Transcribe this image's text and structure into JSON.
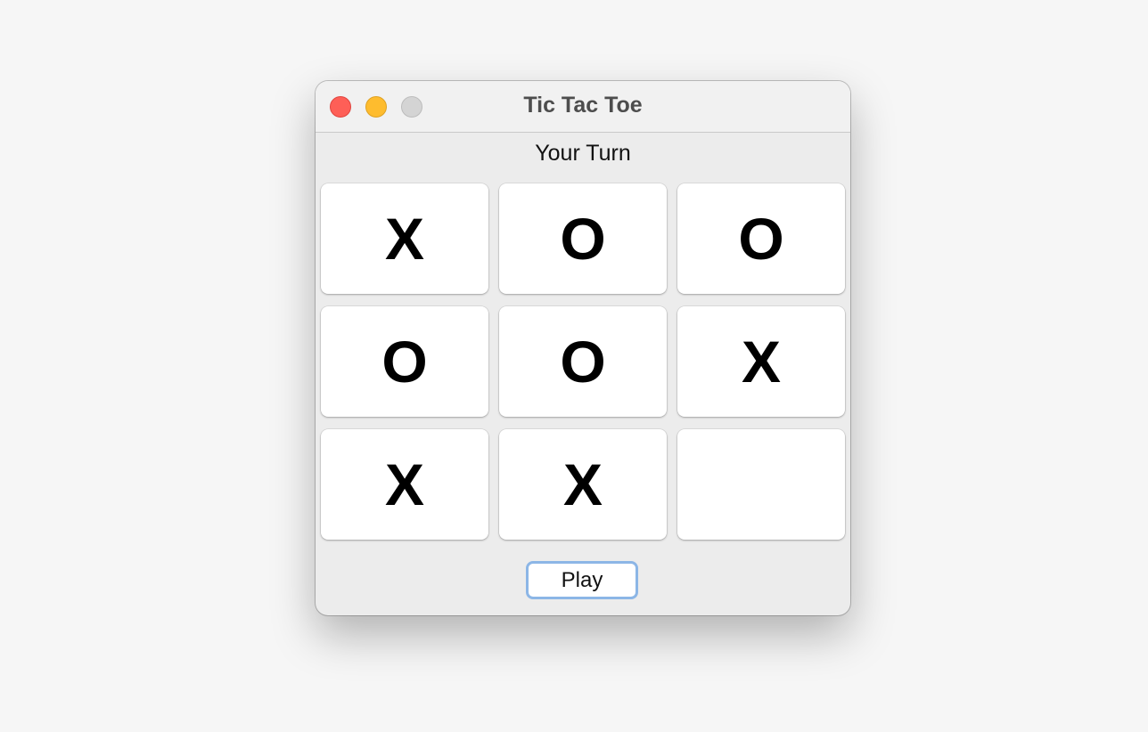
{
  "window": {
    "title": "Tic Tac Toe"
  },
  "status": "Your Turn",
  "board": [
    [
      "X",
      "O",
      "O"
    ],
    [
      "O",
      "O",
      "X"
    ],
    [
      "X",
      "X",
      ""
    ]
  ],
  "play_button": "Play",
  "colors": {
    "close": "#fe5f57",
    "minimize": "#febc2e",
    "zoom": "#d4d4d4",
    "button_border": "#8cb6e6"
  }
}
